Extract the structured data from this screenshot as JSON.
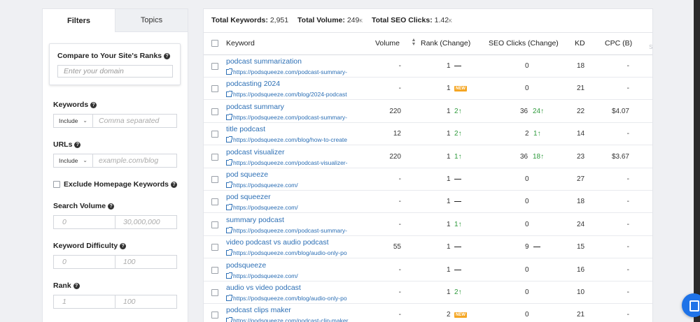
{
  "filters": {
    "tabs": [
      {
        "label": "Filters",
        "active": true
      },
      {
        "label": "Topics",
        "active": false
      }
    ],
    "compare": {
      "label": "Compare to Your Site's Ranks",
      "placeholder": "Enter your domain"
    },
    "keywords": {
      "label": "Keywords",
      "select": "Include",
      "placeholder": "Comma separated"
    },
    "urls": {
      "label": "URLs",
      "select": "Include",
      "placeholder": "example.com/blog"
    },
    "exclude_homepage": {
      "label": "Exclude Homepage Keywords",
      "checked": false
    },
    "search_volume": {
      "label": "Search Volume",
      "min_placeholder": "0",
      "max_placeholder": "30,000,000"
    },
    "keyword_difficulty": {
      "label": "Keyword Difficulty",
      "min_placeholder": "0",
      "max_placeholder": "100"
    },
    "rank": {
      "label": "Rank",
      "min_placeholder": "1",
      "max_placeholder": "100"
    }
  },
  "summary": {
    "total_keywords_label": "Total Keywords:",
    "total_keywords": "2,951",
    "total_volume_label": "Total Volume:",
    "total_volume": "249",
    "total_volume_unit": "K",
    "total_seo_clicks_label": "Total SEO Clicks:",
    "total_seo_clicks": "1.42",
    "total_seo_clicks_unit": "K"
  },
  "table": {
    "columns": {
      "keyword": "Keyword",
      "volume": "Volume",
      "rank": "Rank (Change)",
      "seo_clicks": "SEO Clicks (Change)",
      "kd": "KD",
      "cpc": "CPC (B)"
    },
    "cutoff_col": "S",
    "rows": [
      {
        "keyword": "podcast summarization",
        "url": "https://podsqueeze.com/podcast-summary-",
        "volume": "-",
        "rank": "1",
        "rank_change": "—",
        "rank_change_type": "none",
        "clicks": "0",
        "clicks_change": "",
        "clicks_change_type": "",
        "kd": "18",
        "cpc": "-"
      },
      {
        "keyword": "podcasting 2024",
        "url": "https://podsqueeze.com/blog/2024-podcast",
        "volume": "-",
        "rank": "1",
        "rank_change": "NEW",
        "rank_change_type": "new",
        "clicks": "0",
        "clicks_change": "",
        "clicks_change_type": "",
        "kd": "21",
        "cpc": "-"
      },
      {
        "keyword": "podcast summary",
        "url": "https://podsqueeze.com/podcast-summary-",
        "volume": "220",
        "rank": "1",
        "rank_change": "2",
        "rank_change_type": "up",
        "clicks": "36",
        "clicks_change": "24",
        "clicks_change_type": "up",
        "kd": "22",
        "cpc": "$4.07"
      },
      {
        "keyword": "title podcast",
        "url": "https://podsqueeze.com/blog/how-to-create",
        "volume": "12",
        "rank": "1",
        "rank_change": "2",
        "rank_change_type": "up",
        "clicks": "2",
        "clicks_change": "1",
        "clicks_change_type": "up",
        "kd": "14",
        "cpc": "-"
      },
      {
        "keyword": "podcast visualizer",
        "url": "https://podsqueeze.com/podcast-visualizer-",
        "volume": "220",
        "rank": "1",
        "rank_change": "1",
        "rank_change_type": "up",
        "clicks": "36",
        "clicks_change": "18",
        "clicks_change_type": "up",
        "kd": "23",
        "cpc": "$3.67"
      },
      {
        "keyword": "pod squeeze",
        "url": "https://podsqueeze.com/",
        "volume": "-",
        "rank": "1",
        "rank_change": "—",
        "rank_change_type": "none",
        "clicks": "0",
        "clicks_change": "",
        "clicks_change_type": "",
        "kd": "27",
        "cpc": "-"
      },
      {
        "keyword": "pod squeezer",
        "url": "https://podsqueeze.com/",
        "volume": "-",
        "rank": "1",
        "rank_change": "—",
        "rank_change_type": "none",
        "clicks": "0",
        "clicks_change": "",
        "clicks_change_type": "",
        "kd": "18",
        "cpc": "-"
      },
      {
        "keyword": "summary podcast",
        "url": "https://podsqueeze.com/podcast-summary-",
        "volume": "-",
        "rank": "1",
        "rank_change": "1",
        "rank_change_type": "up",
        "clicks": "0",
        "clicks_change": "",
        "clicks_change_type": "",
        "kd": "24",
        "cpc": "-"
      },
      {
        "keyword": "video podcast vs audio podcast",
        "url": "https://podsqueeze.com/blog/audio-only-po",
        "volume": "55",
        "rank": "1",
        "rank_change": "—",
        "rank_change_type": "none",
        "clicks": "9",
        "clicks_change": "—",
        "clicks_change_type": "none",
        "kd": "15",
        "cpc": "-"
      },
      {
        "keyword": "podsqueeze",
        "url": "https://podsqueeze.com/",
        "volume": "-",
        "rank": "1",
        "rank_change": "—",
        "rank_change_type": "none",
        "clicks": "0",
        "clicks_change": "",
        "clicks_change_type": "",
        "kd": "16",
        "cpc": "-"
      },
      {
        "keyword": "audio vs video podcast",
        "url": "https://podsqueeze.com/blog/audio-only-po",
        "volume": "-",
        "rank": "1",
        "rank_change": "2",
        "rank_change_type": "up",
        "clicks": "0",
        "clicks_change": "",
        "clicks_change_type": "",
        "kd": "10",
        "cpc": "-"
      },
      {
        "keyword": "podcast clips maker",
        "url": "https://podsqueeze.com/podcast-clip-maker",
        "volume": "-",
        "rank": "2",
        "rank_change": "NEW",
        "rank_change_type": "new",
        "clicks": "0",
        "clicks_change": "",
        "clicks_change_type": "",
        "kd": "21",
        "cpc": "-"
      }
    ]
  },
  "colors": {
    "link": "#2c6fb5",
    "up": "#2e9a3c",
    "new_badge": "#f5a623",
    "chat": "#1f73e8"
  }
}
